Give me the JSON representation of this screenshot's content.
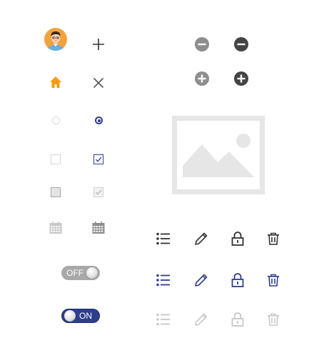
{
  "colors": {
    "brand_orange": "#f39c12",
    "accent_navy": "#2e3e8e",
    "icon_dark": "#333333",
    "icon_gray": "#999999",
    "icon_disabled": "#c8c8c8",
    "placeholder_gray": "#e6e6e6"
  },
  "icons": {
    "avatar": "user-avatar-icon",
    "add": "plus-icon",
    "close": "close-icon",
    "home": "home-icon",
    "calendar": "calendar-icon",
    "remove": "minus-circle-icon",
    "add_circle": "plus-circle-icon",
    "image": "image-placeholder-icon",
    "list": "list-icon",
    "edit": "pencil-icon",
    "lock": "lock-icon",
    "delete": "trash-icon"
  },
  "controls": {
    "radio_unselected": false,
    "radio_selected": true,
    "checkbox_empty": false,
    "checkbox_checked": true,
    "checkbox_disabled": false,
    "checkbox_disabled_checked": true
  },
  "toggles": {
    "off_label": "OFF",
    "on_label": "ON",
    "off_state": false,
    "on_state": true
  },
  "icon_rows": [
    "default",
    "active",
    "disabled"
  ]
}
